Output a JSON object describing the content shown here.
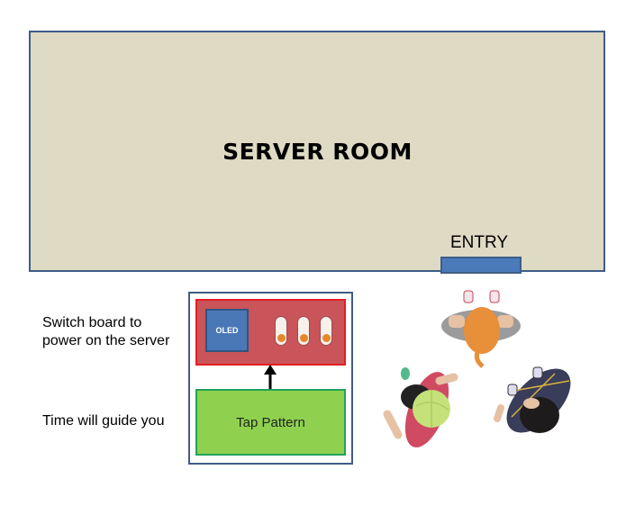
{
  "server_room": {
    "title": "SERVER ROOM",
    "entry_label": "ENTRY"
  },
  "switchboard": {
    "oled_label": "OLED",
    "toggle_count": 3
  },
  "tap_pattern": {
    "label": "Tap Pattern"
  },
  "labels": {
    "switch_board_line1": "Switch board to",
    "switch_board_line2": "power on the server",
    "time_hint": "Time will guide you"
  },
  "colors": {
    "room_fill": "#dfdac4",
    "outline": "#3e5d86",
    "door": "#4a7ab9",
    "switchboard_fill": "#c9545a",
    "switchboard_border": "#e31e24",
    "oled_fill": "#4a78b6",
    "tap_fill": "#8fd14f",
    "tap_border": "#23a25a"
  }
}
